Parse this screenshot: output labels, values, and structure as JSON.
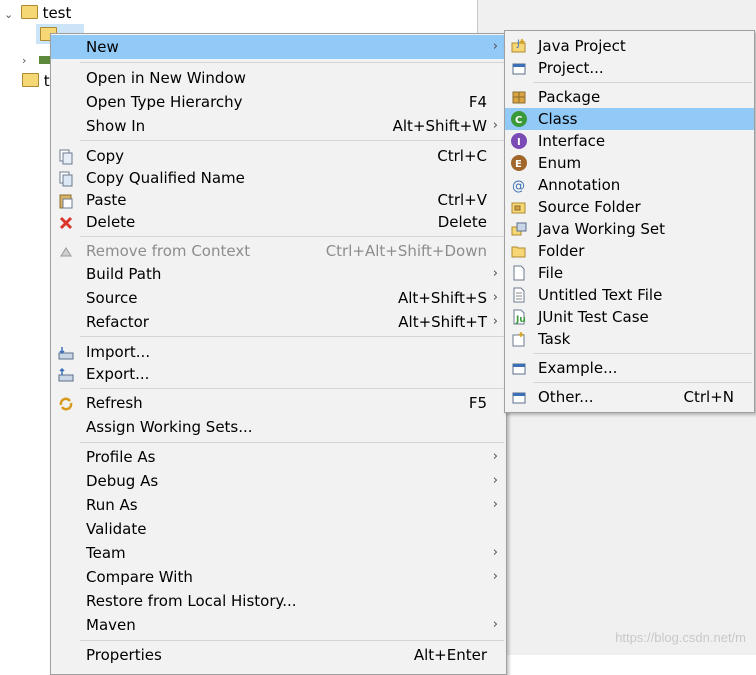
{
  "tree": {
    "items": [
      {
        "label": "test",
        "icon": "project-folder-icon"
      },
      {
        "label": "",
        "icon": "folder-icon"
      },
      {
        "label": "",
        "icon": "library-icon"
      },
      {
        "label": "t",
        "icon": "project-folder-icon"
      }
    ]
  },
  "context_menu": {
    "new": {
      "label": "New"
    },
    "open_new_window": {
      "label": "Open in New Window"
    },
    "open_type_hierarchy": {
      "label": "Open Type Hierarchy",
      "shortcut": "F4"
    },
    "show_in": {
      "label": "Show In",
      "shortcut": "Alt+Shift+W"
    },
    "copy": {
      "label": "Copy",
      "shortcut": "Ctrl+C"
    },
    "copy_qualified_name": {
      "label": "Copy Qualified Name"
    },
    "paste": {
      "label": "Paste",
      "shortcut": "Ctrl+V"
    },
    "delete": {
      "label": "Delete",
      "shortcut": "Delete"
    },
    "remove_from_context": {
      "label": "Remove from Context",
      "shortcut": "Ctrl+Alt+Shift+Down"
    },
    "build_path": {
      "label": "Build Path"
    },
    "source": {
      "label": "Source",
      "shortcut": "Alt+Shift+S"
    },
    "refactor": {
      "label": "Refactor",
      "shortcut": "Alt+Shift+T"
    },
    "import": {
      "label": "Import..."
    },
    "export": {
      "label": "Export..."
    },
    "refresh": {
      "label": "Refresh",
      "shortcut": "F5"
    },
    "assign_working_sets": {
      "label": "Assign Working Sets..."
    },
    "profile_as": {
      "label": "Profile As"
    },
    "debug_as": {
      "label": "Debug As"
    },
    "run_as": {
      "label": "Run As"
    },
    "validate": {
      "label": "Validate"
    },
    "team": {
      "label": "Team"
    },
    "compare_with": {
      "label": "Compare With"
    },
    "restore_local_history": {
      "label": "Restore from Local History..."
    },
    "maven": {
      "label": "Maven"
    },
    "properties": {
      "label": "Properties",
      "shortcut": "Alt+Enter"
    }
  },
  "new_submenu": {
    "java_project": {
      "label": "Java Project"
    },
    "project": {
      "label": "Project..."
    },
    "package": {
      "label": "Package"
    },
    "class": {
      "label": "Class"
    },
    "interface": {
      "label": "Interface"
    },
    "enum": {
      "label": "Enum"
    },
    "annotation": {
      "label": "Annotation"
    },
    "source_folder": {
      "label": "Source Folder"
    },
    "java_working_set": {
      "label": "Java Working Set"
    },
    "folder": {
      "label": "Folder"
    },
    "file": {
      "label": "File"
    },
    "untitled_text_file": {
      "label": "Untitled Text File"
    },
    "junit_test_case": {
      "label": "JUnit Test Case"
    },
    "task": {
      "label": "Task"
    },
    "example": {
      "label": "Example..."
    },
    "other": {
      "label": "Other...",
      "shortcut": "Ctrl+N"
    }
  },
  "watermark": "https://blog.csdn.net/m",
  "colors": {
    "menu_bg": "#f2f2f2",
    "highlight": "#91c9f7",
    "disabled_text": "#8d8d8d",
    "delete_red": "#d9352b",
    "class_green": "#3a9a3a",
    "interface_purple": "#7b4bb5",
    "enum_brown": "#a0662a"
  }
}
